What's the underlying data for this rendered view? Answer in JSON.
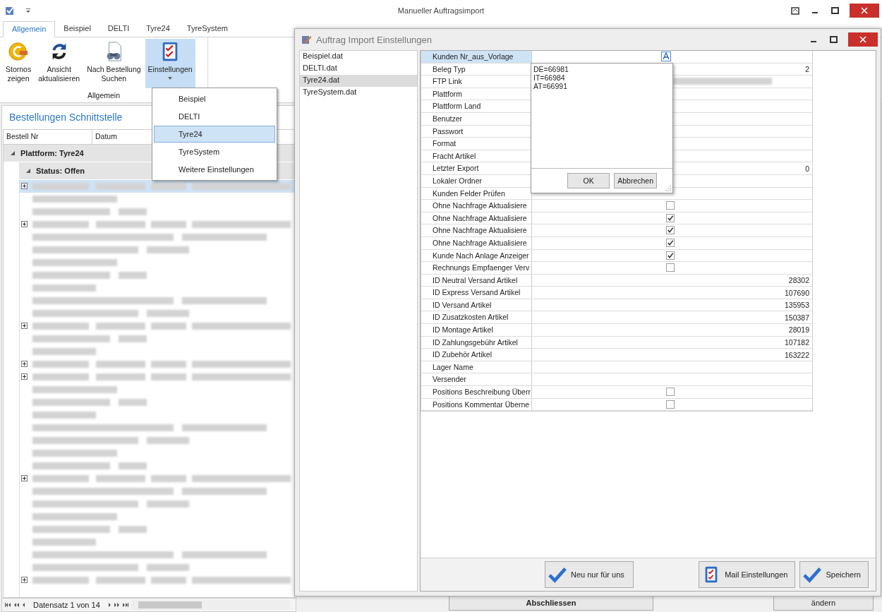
{
  "window": {
    "title": "Manueller Auftragsimport"
  },
  "ribbon_tabs": [
    {
      "label": "Allgemein",
      "selected": true
    },
    {
      "label": "Beispiel",
      "selected": false
    },
    {
      "label": "DELTI",
      "selected": false
    },
    {
      "label": "Tyre24",
      "selected": false
    },
    {
      "label": "TyreSystem",
      "selected": false
    }
  ],
  "ribbon": {
    "buttons": [
      {
        "kind": "coin",
        "label": "Stornos\nzeigen",
        "selected": false,
        "dropdown": false
      },
      {
        "kind": "refresh",
        "label": "Ansicht\naktualisieren",
        "selected": false,
        "dropdown": false
      },
      {
        "kind": "search",
        "label": "Nach Bestellung\nSuchen",
        "selected": false,
        "dropdown": false
      },
      {
        "kind": "checklist",
        "label": "Einstellungen",
        "selected": true,
        "dropdown": true
      }
    ],
    "group_label": "Allgemein"
  },
  "dropdown_menu": [
    {
      "label": "Beispiel",
      "selected": false
    },
    {
      "label": "DELTI",
      "selected": false
    },
    {
      "label": "Tyre24",
      "selected": true
    },
    {
      "label": "TyreSystem",
      "selected": false
    },
    {
      "label": "Weitere Einstellungen",
      "selected": false
    }
  ],
  "orders_panel": {
    "title": "Bestellungen Schnittstelle",
    "columns": [
      "Bestell Nr",
      "Datum"
    ],
    "group": "Plattform: Tyre24",
    "subgroup": "Status: Offen",
    "pager": "Datensatz 1 von 14"
  },
  "background_buttons": [
    {
      "kind": "check",
      "label": "Abschliessen"
    },
    {
      "kind": "blue",
      "label": "ändern"
    }
  ],
  "dialog": {
    "title": "Auftrag Import Einstellungen",
    "files": [
      {
        "name": "Beispiel.dat",
        "selected": false
      },
      {
        "name": "DELTI.dat",
        "selected": false
      },
      {
        "name": "Tyre24.dat",
        "selected": true
      },
      {
        "name": "TyreSystem.dat",
        "selected": false
      }
    ],
    "properties": [
      {
        "label": "Kunden Nr_aus_Vorlage",
        "kind": "editor",
        "selected": true
      },
      {
        "label": "Beleg Typ",
        "kind": "text",
        "value": "2",
        "selected": false
      },
      {
        "label": "FTP Link",
        "kind": "hidden",
        "selected": false
      },
      {
        "label": "Plattform",
        "kind": "text",
        "selected": false
      },
      {
        "label": "Plattform Land",
        "kind": "text",
        "selected": false
      },
      {
        "label": "Benutzer",
        "kind": "text",
        "selected": false
      },
      {
        "label": "Passwort",
        "kind": "text",
        "selected": false
      },
      {
        "label": "Format",
        "kind": "text",
        "selected": false
      },
      {
        "label": "Fracht Artikel",
        "kind": "text",
        "selected": false
      },
      {
        "label": "Letzter Export",
        "kind": "text",
        "value": "0",
        "selected": false
      },
      {
        "label": "Lokaler Ordner",
        "kind": "text",
        "selected": false
      },
      {
        "label": "Kunden Felder Prüfen",
        "kind": "text",
        "selected": false
      },
      {
        "label": "Ohne Nachfrage Aktualisiere",
        "kind": "checkbox",
        "checked": false,
        "selected": false
      },
      {
        "label": "Ohne Nachfrage Aktualisiere",
        "kind": "checkbox",
        "checked": true,
        "selected": false
      },
      {
        "label": "Ohne Nachfrage Aktualisiere",
        "kind": "checkbox",
        "checked": true,
        "selected": false
      },
      {
        "label": "Ohne Nachfrage Aktualisiere",
        "kind": "checkbox",
        "checked": true,
        "selected": false
      },
      {
        "label": "Kunde Nach Anlage Anzeiger",
        "kind": "checkbox",
        "checked": true,
        "selected": false
      },
      {
        "label": "Rechnungs Empfaenger Verv",
        "kind": "checkbox",
        "checked": false,
        "selected": false
      },
      {
        "label": "ID Neutral Versand Artikel",
        "kind": "text",
        "value": "28302",
        "selected": false
      },
      {
        "label": "ID Express Versand Artikel",
        "kind": "text",
        "value": "107690",
        "selected": false
      },
      {
        "label": "ID Versand Artikel",
        "kind": "text",
        "value": "135953",
        "selected": false
      },
      {
        "label": "ID Zusatzkosten Artikel",
        "kind": "text",
        "value": "150387",
        "selected": false
      },
      {
        "label": "ID Montage Artikel",
        "kind": "text",
        "value": "28019",
        "selected": false
      },
      {
        "label": "ID Zahlungsgebühr Artikel",
        "kind": "text",
        "value": "107182",
        "selected": false
      },
      {
        "label": "ID Zubehör Artikel",
        "kind": "text",
        "value": "163222",
        "selected": false
      },
      {
        "label": "Lager Name",
        "kind": "text",
        "selected": false
      },
      {
        "label": "Versender",
        "kind": "text",
        "selected": false
      },
      {
        "label": "Positions Beschreibung Überr",
        "kind": "checkbox",
        "checked": false,
        "selected": false
      },
      {
        "label": "Positions Kommentar Überne",
        "kind": "checkbox",
        "checked": false,
        "selected": false
      }
    ],
    "editor": {
      "value": "DE=66981\nIT=66984\nAT=66991",
      "buttons": [
        "OK",
        "Abbrechen"
      ]
    },
    "buttons": [
      {
        "kind": "check",
        "label": "Neu nur für uns"
      },
      {
        "kind": "checklist",
        "label": "Mail Einstellungen"
      },
      {
        "kind": "check",
        "label": "Speichern"
      }
    ]
  }
}
